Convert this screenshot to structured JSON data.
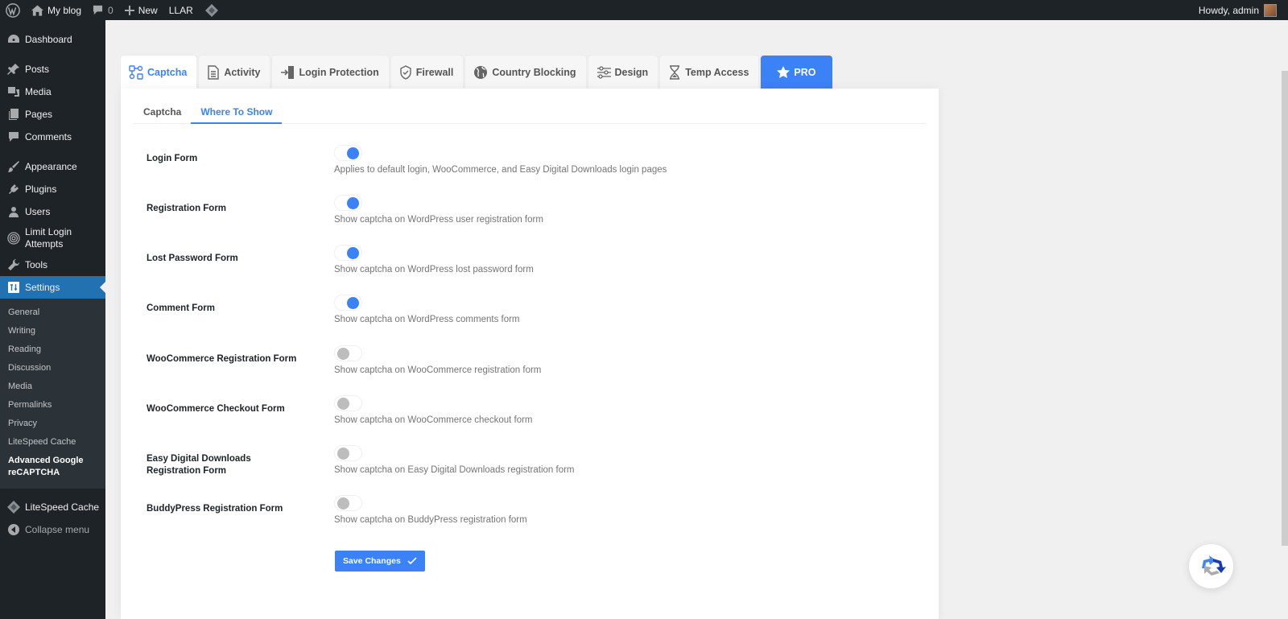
{
  "adminbar": {
    "site_name": "My blog",
    "comments_count": "0",
    "new_label": "New",
    "llar_label": "LLAR",
    "greeting": "Howdy, admin"
  },
  "sidebar": {
    "items": [
      {
        "label": "Dashboard",
        "icon": "dashboard-icon"
      },
      {
        "label": "Posts",
        "icon": "pin-icon"
      },
      {
        "label": "Media",
        "icon": "media-icon"
      },
      {
        "label": "Pages",
        "icon": "pages-icon"
      },
      {
        "label": "Comments",
        "icon": "comment-icon"
      },
      {
        "label": "Appearance",
        "icon": "brush-icon"
      },
      {
        "label": "Plugins",
        "icon": "plugin-icon"
      },
      {
        "label": "Users",
        "icon": "user-icon"
      },
      {
        "label": "Limit Login Attempts",
        "icon": "fingerprint-icon"
      },
      {
        "label": "Tools",
        "icon": "wrench-icon"
      },
      {
        "label": "Settings",
        "icon": "settings-icon",
        "active": true
      }
    ],
    "submenu": [
      "General",
      "Writing",
      "Reading",
      "Discussion",
      "Media",
      "Permalinks",
      "Privacy",
      "LiteSpeed Cache",
      "Advanced Google reCAPTCHA"
    ],
    "litespeed_label": "LiteSpeed Cache",
    "collapse_label": "Collapse menu"
  },
  "tabs": [
    {
      "label": "Captcha",
      "icon": "captcha-icon",
      "active": true
    },
    {
      "label": "Activity",
      "icon": "document-icon"
    },
    {
      "label": "Login Protection",
      "icon": "login-icon"
    },
    {
      "label": "Firewall",
      "icon": "shield-check-icon"
    },
    {
      "label": "Country Blocking",
      "icon": "globe-icon"
    },
    {
      "label": "Design",
      "icon": "sliders-icon"
    },
    {
      "label": "Temp Access",
      "icon": "hourglass-icon"
    },
    {
      "label": "PRO",
      "icon": "star-icon",
      "pro": true
    }
  ],
  "subtabs": [
    {
      "label": "Captcha"
    },
    {
      "label": "Where To Show",
      "active": true
    }
  ],
  "settings": [
    {
      "label": "Login Form",
      "enabled": true,
      "desc": "Applies to default login, WooCommerce, and Easy Digital Downloads login pages"
    },
    {
      "label": "Registration Form",
      "enabled": true,
      "desc": "Show captcha on WordPress user registration form"
    },
    {
      "label": "Lost Password Form",
      "enabled": true,
      "desc": "Show captcha on WordPress lost password form"
    },
    {
      "label": "Comment Form",
      "enabled": true,
      "desc": "Show captcha on WordPress comments form"
    },
    {
      "label": "WooCommerce Registration Form",
      "enabled": false,
      "desc": "Show captcha on WooCommerce registration form"
    },
    {
      "label": "WooCommerce Checkout Form",
      "enabled": false,
      "desc": "Show captcha on WooCommerce checkout form"
    },
    {
      "label": "Easy Digital Downloads Registration Form",
      "enabled": false,
      "desc": "Show captcha on Easy Digital Downloads registration form"
    },
    {
      "label": "BuddyPress Registration Form",
      "enabled": false,
      "desc": "Show captcha on BuddyPress registration form"
    }
  ],
  "save_label": "Save Changes",
  "colors": {
    "accent": "#3b82f6",
    "wp_blue": "#2271b1",
    "admin_dark": "#1d2327"
  }
}
